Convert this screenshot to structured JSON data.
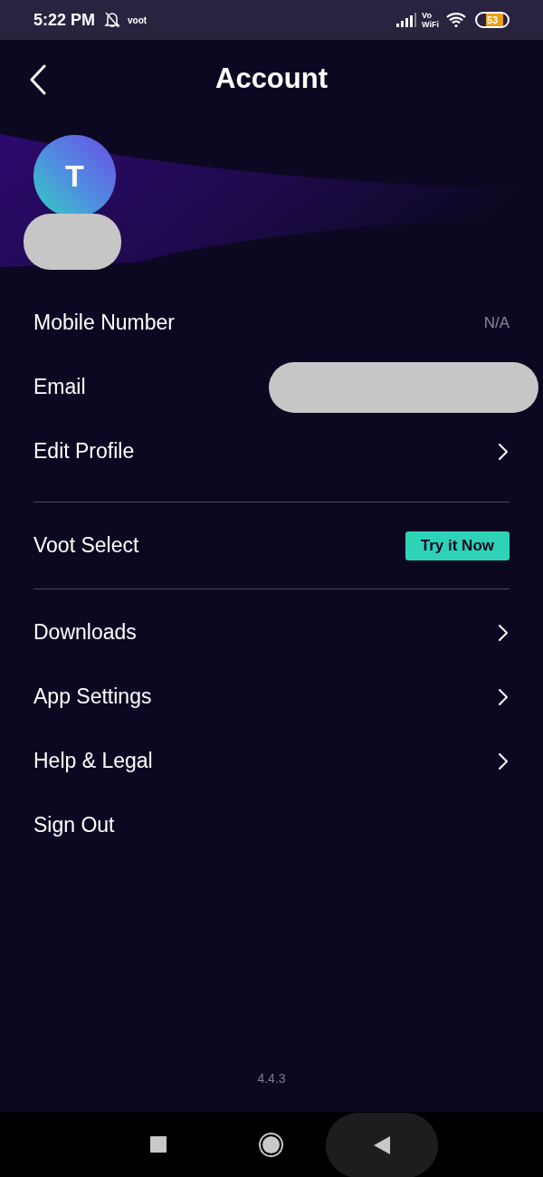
{
  "status_bar": {
    "time": "5:22 PM",
    "app_badge": "voot",
    "network_label": "Vo\nWiFi",
    "battery": "53"
  },
  "header": {
    "title": "Account"
  },
  "profile": {
    "initial": "T"
  },
  "sections": [
    [
      {
        "kind": "value",
        "label": "Mobile Number",
        "value": "N/A"
      },
      {
        "kind": "redacted",
        "label": "Email"
      },
      {
        "kind": "link",
        "label": "Edit Profile"
      }
    ],
    [
      {
        "kind": "promo",
        "label": "Voot Select",
        "action": "Try it Now"
      }
    ],
    [
      {
        "kind": "link",
        "label": "Downloads"
      },
      {
        "kind": "link",
        "label": "App Settings"
      },
      {
        "kind": "link",
        "label": "Help & Legal"
      },
      {
        "kind": "plain",
        "label": "Sign Out"
      }
    ]
  ],
  "version": "4.4.3"
}
